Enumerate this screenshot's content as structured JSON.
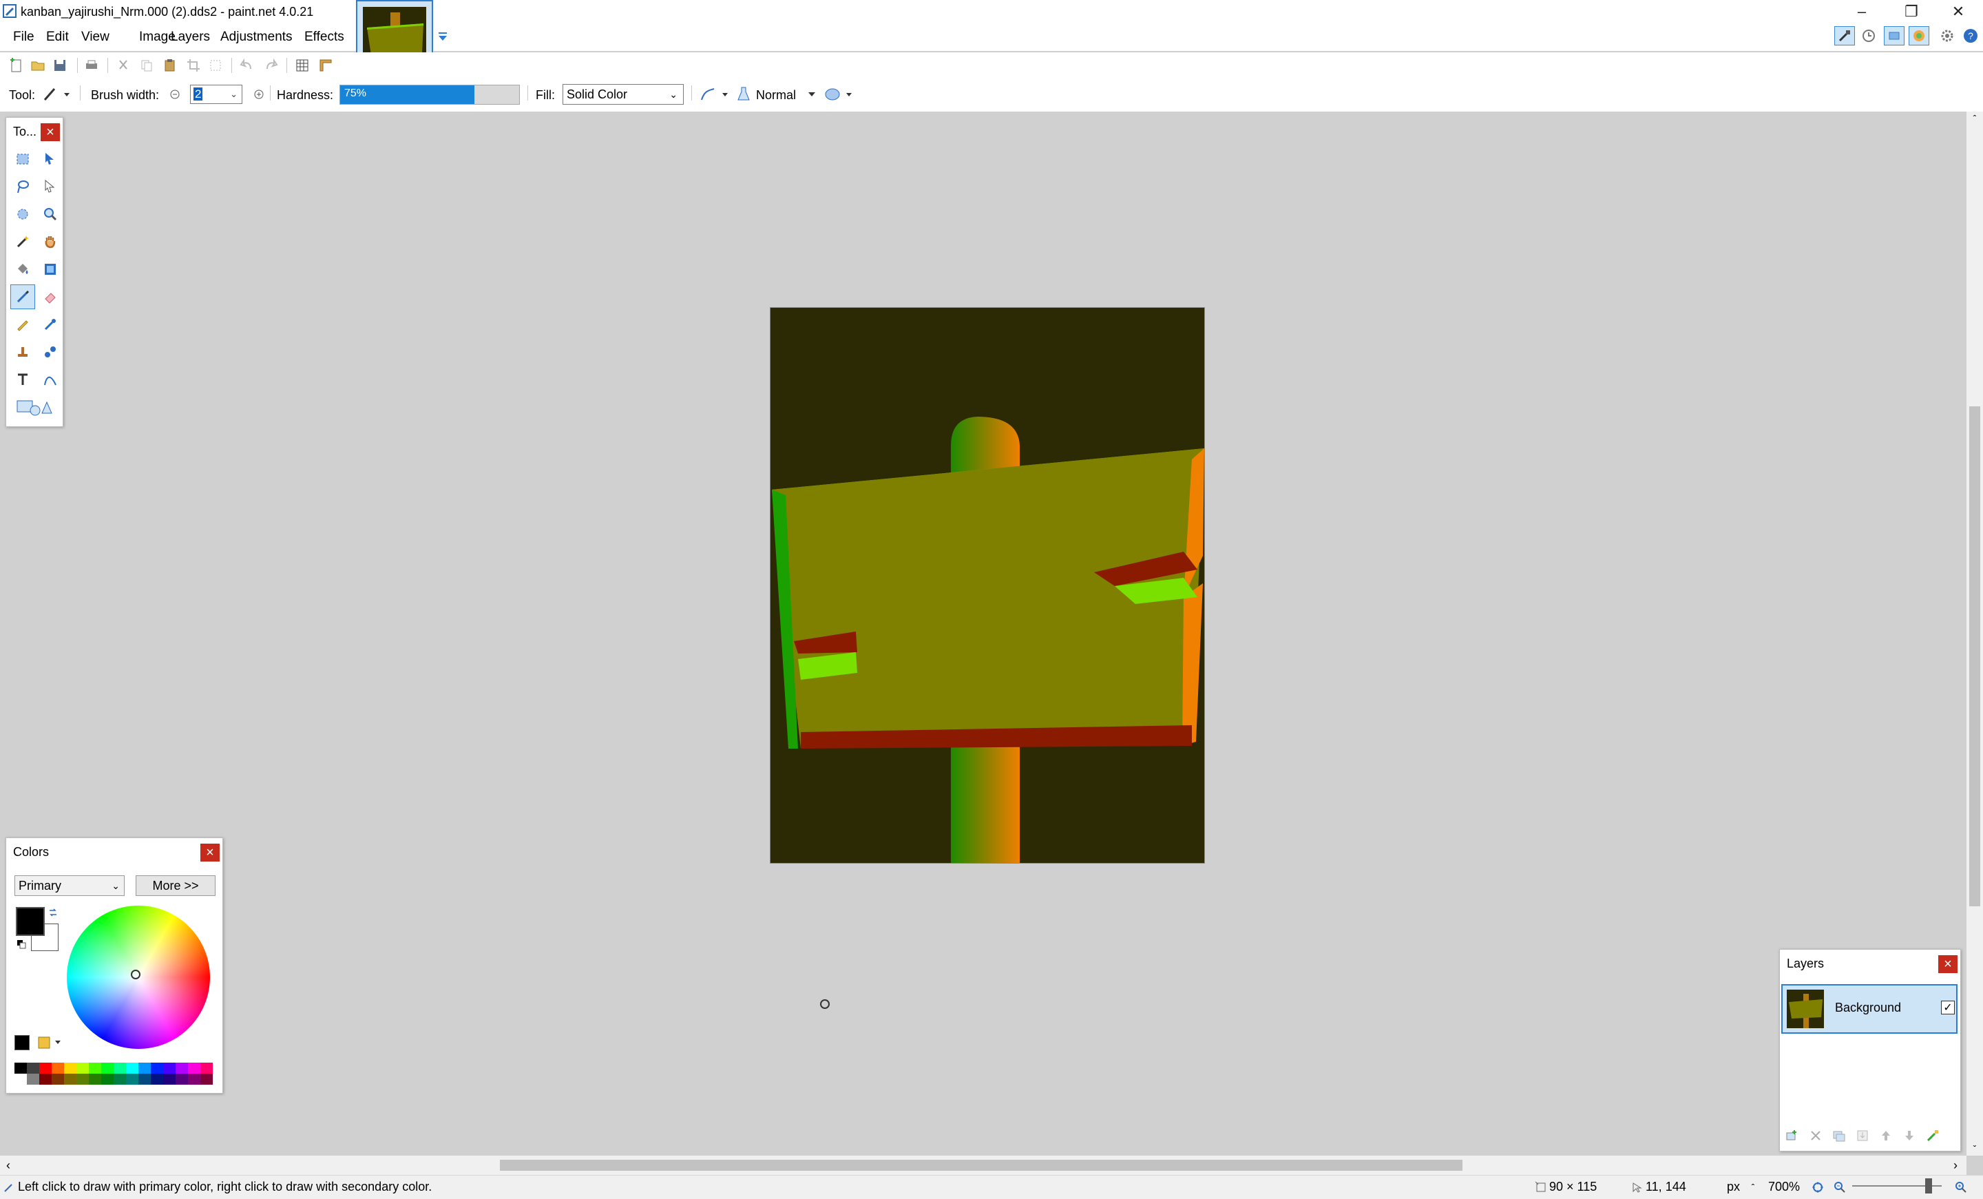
{
  "window": {
    "title": "kanban_yajirushi_Nrm.000 (2).dds2 - paint.net 4.0.21"
  },
  "menu": [
    "File",
    "Edit",
    "View",
    "Image",
    "Layers",
    "Adjustments",
    "Effects"
  ],
  "tool_options": {
    "tool_label": "Tool:",
    "brush_width_label": "Brush width:",
    "brush_width_value": "2",
    "hardness_label": "Hardness:",
    "hardness_value": "75%",
    "hardness_fraction": 0.75,
    "fill_label": "Fill:",
    "fill_value": "Solid Color",
    "blend_mode": "Normal"
  },
  "tools_window": {
    "title": "To..."
  },
  "colors_window": {
    "title": "Colors",
    "select_value": "Primary",
    "more_button": "More >>",
    "primary_color": "#000000",
    "secondary_color": "#ffffff",
    "palette_top": [
      "#000000",
      "#404040",
      "#ff0000",
      "#ff6a00",
      "#ffd800",
      "#b6ff00",
      "#4cff00",
      "#00ff21",
      "#00ff90",
      "#00ffff",
      "#0094ff",
      "#0026ff",
      "#4800ff",
      "#b200ff",
      "#ff00dc",
      "#ff006e"
    ],
    "palette_bottom": [
      "#ffffff",
      "#808080",
      "#7f0000",
      "#7f3300",
      "#7f6a00",
      "#5b7f00",
      "#267f00",
      "#007f0e",
      "#007f46",
      "#007f7f",
      "#004a7f",
      "#00137f",
      "#21007f",
      "#57007f",
      "#7f006e",
      "#7f0037"
    ]
  },
  "layers_window": {
    "title": "Layers",
    "layer_name": "Background",
    "layer_visible": true
  },
  "status": {
    "hint": "Left click to draw with primary color, right click to draw with secondary color.",
    "image_size": "90 × 115",
    "cursor_pos": "11, 144",
    "units": "px",
    "zoom": "700%"
  }
}
